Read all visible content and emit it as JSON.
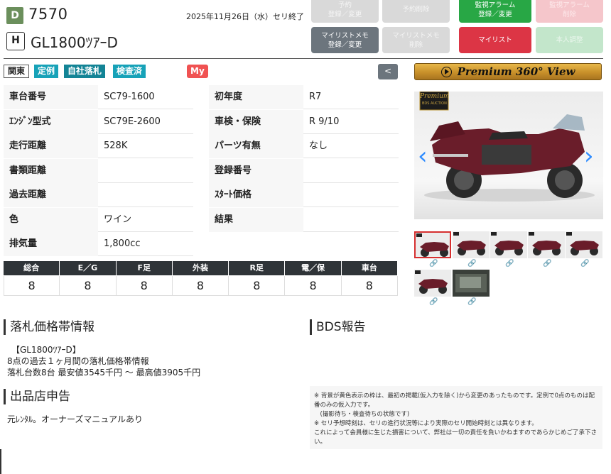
{
  "header": {
    "grade_badge": "D",
    "lot_number": "7570",
    "end_date": "2025年11月26日（水）セリ終了",
    "type_badge": "H",
    "model": "GL1800ﾂｱｰD"
  },
  "header_buttons": [
    {
      "label": "予約\n登録／変更"
    },
    {
      "label": "予約削除"
    },
    {
      "label": "監視アラーム\n登録／変更"
    },
    {
      "label": "監視アラーム\n削除"
    },
    {
      "label": "マイリストメモ\n登録／変更"
    },
    {
      "label": "マイリストメモ\n削除"
    },
    {
      "label": "マイリスト"
    },
    {
      "label": "本人調整"
    }
  ],
  "tags": [
    "関東",
    "定例",
    "自社落札",
    "検査済"
  ],
  "my_tag": "My",
  "back_button": "<",
  "specs_left": [
    {
      "label": "車台番号",
      "value": "SC79-1600"
    },
    {
      "label": "ｴﾝｼﾞﾝ型式",
      "value": "SC79E-2600"
    },
    {
      "label": "走行距離",
      "value": "528K"
    },
    {
      "label": "書類距離",
      "value": ""
    },
    {
      "label": "過去距離",
      "value": ""
    },
    {
      "label": "色",
      "value": "ワイン"
    },
    {
      "label": "排気量",
      "value": "1,800cc"
    }
  ],
  "specs_right": [
    {
      "label": "初年度",
      "value": "R7"
    },
    {
      "label": "車検・保険",
      "value": "R 9/10"
    },
    {
      "label": "パーツ有無",
      "value": "なし"
    },
    {
      "label": "登録番号",
      "value": ""
    },
    {
      "label": "ｽﾀｰﾄ価格",
      "value": ""
    },
    {
      "label": "結果",
      "value": ""
    }
  ],
  "scores": {
    "headers": [
      "総合",
      "E／G",
      "F足",
      "外装",
      "R足",
      "電／保",
      "車台"
    ],
    "values": [
      "8",
      "8",
      "8",
      "8",
      "8",
      "8",
      "8"
    ]
  },
  "price_section": {
    "title": "落札価格帯情報",
    "model_line": "【GL1800ﾂｱｰD】",
    "line1": "8点の過去１ヶ月間の落札価格帯情報",
    "line2": "落札台数8台 最安値3545千円 〜 最高値3905千円"
  },
  "bds_section": {
    "title": "BDS報告"
  },
  "shop_section": {
    "title": "出品店申告",
    "text": "元ﾚﾝﾀﾙ。オーナーズマニュアルあり"
  },
  "notice": "※ 背景が黄色表示の枠は、最初の掲載(仮入力を除く)から変更のあったものです。定例で0点のものは配番のみの仮入力です。\n　(撮影待ち・検査待ちの状態です)\n※ セリ予想時刻は、セリの進行状況等により実際のセリ開始時刻とは異なります。\nこれによって会員様に生じた損害について、弊社は一切の責任を負いかねますのであらかじめご了承下さい。",
  "premium_view": {
    "label": "Premium 360° View"
  },
  "photo_badge": {
    "line1": "Premium",
    "line2": "BDS AUCTION"
  },
  "colors": {
    "accent_green": "#28a745",
    "accent_red": "#dc3545",
    "score_header": "#2f3438",
    "teal": "#17a2b8",
    "bike_body": "#6a1d2a"
  },
  "icons": {
    "thumbnail_link": "link-icon",
    "prev": "chevron-left-icon",
    "next": "chevron-right-icon"
  }
}
